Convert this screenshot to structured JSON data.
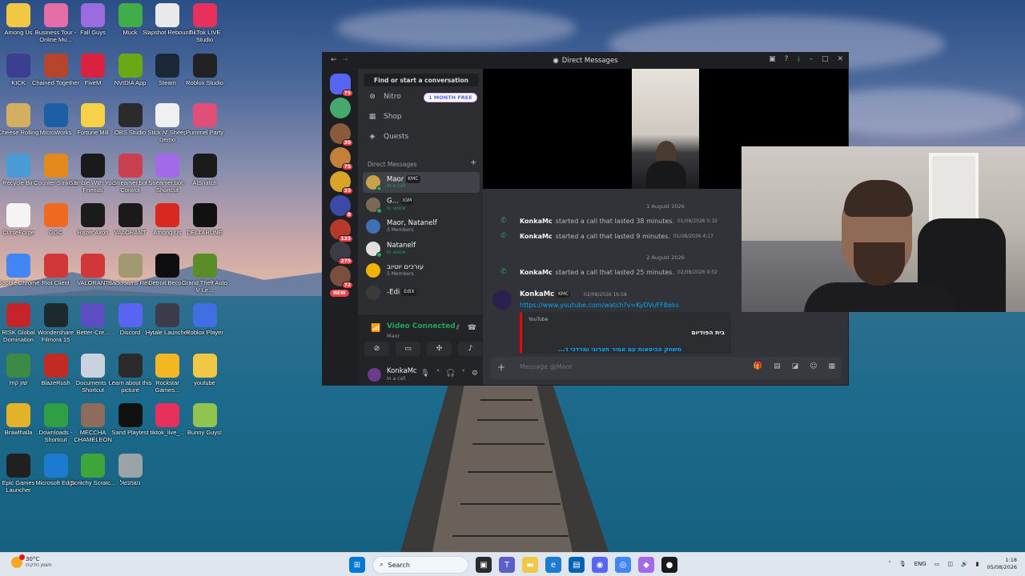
{
  "desktop_icons": [
    {
      "label": "Among Us",
      "icon": "folder-icon",
      "color": "#f2c744"
    },
    {
      "label": "Business Tour - Online Mu...",
      "icon": "business-tour-icon",
      "color": "#e46fa8"
    },
    {
      "label": "Fall Guys",
      "icon": "fall-guys-icon",
      "color": "#9b6ce0"
    },
    {
      "label": "Muck",
      "icon": "muck-icon",
      "color": "#3fae48"
    },
    {
      "label": "Slapshot Rebound",
      "icon": "slapshot-icon",
      "color": "#e9e9e9"
    },
    {
      "label": "TikTok LIVE Studio",
      "icon": "tiktok-icon",
      "color": "#e8305c"
    },
    {
      "label": "KICK",
      "icon": "kick-icon",
      "color": "#3b3f8f"
    },
    {
      "label": "Chained Together",
      "icon": "chained-icon",
      "color": "#b5452c"
    },
    {
      "label": "FiveM",
      "icon": "fivem-icon",
      "color": "#d8223f"
    },
    {
      "label": "NVIDIA App",
      "icon": "nvidia-icon",
      "color": "#6aa815"
    },
    {
      "label": "Steam",
      "icon": "steam-icon",
      "color": "#1b2838"
    },
    {
      "label": "Roblox Studio",
      "icon": "roblox-studio-icon",
      "color": "#222"
    },
    {
      "label": "Cheese Rolling",
      "icon": "cheese-icon",
      "color": "#d3b061"
    },
    {
      "label": "MicroWorks",
      "icon": "microworks-icon",
      "color": "#1d5fa5"
    },
    {
      "label": "Fortune Mill",
      "icon": "fortune-mill-icon",
      "color": "#f7d246"
    },
    {
      "label": "OBS Studio",
      "icon": "obs-icon",
      "color": "#2b2b2b"
    },
    {
      "label": "Stick N' Sheep Demo",
      "icon": "stick-sheep-icon",
      "color": "#f0f0f0"
    },
    {
      "label": "Pummel Party",
      "icon": "pummel-party-icon",
      "color": "#e04f77"
    },
    {
      "label": "Recycle Bin",
      "icon": "recycle-bin-icon",
      "color": "#4a9ad4"
    },
    {
      "label": "Counter-Strike 2",
      "icon": "cs2-icon",
      "color": "#e28b1c"
    },
    {
      "label": "Gamble With Your Friends",
      "icon": "gamble-icon",
      "color": "#1a1a1a"
    },
    {
      "label": "Streamer.bot Control",
      "icon": "streamerbot-icon",
      "color": "#c94150"
    },
    {
      "label": "Streamer.bot - Shortcut",
      "icon": "streamerbot-shortcut-icon",
      "color": "#a26ae8"
    },
    {
      "label": "AlSnatch",
      "icon": "alsnatch-icon",
      "color": "#1b1b1b"
    },
    {
      "label": "CurseForge",
      "icon": "curseforge-icon",
      "color": "#f4f4f4"
    },
    {
      "label": "GGC",
      "icon": "ggc-icon",
      "color": "#ef6a20"
    },
    {
      "label": "Razer Axon",
      "icon": "razer-icon",
      "color": "#1b1b1b"
    },
    {
      "label": "VALORANT",
      "icon": "valorant-icon",
      "color": "#1a1a1a"
    },
    {
      "label": "Among Us",
      "icon": "among-us-icon",
      "color": "#d8281f"
    },
    {
      "label": "DELTARUNE",
      "icon": "deltarune-icon",
      "color": "#111"
    },
    {
      "label": "Google Chrome",
      "icon": "chrome-icon",
      "color": "#4285f4"
    },
    {
      "label": "Riot Client",
      "icon": "riot-client-icon",
      "color": "#d13639"
    },
    {
      "label": "VALORANT",
      "icon": "valorant-riot-icon",
      "color": "#d13639"
    },
    {
      "label": "Backrooms Rec.",
      "icon": "backrooms-icon",
      "color": "#a29871"
    },
    {
      "label": "Detroit Beco...",
      "icon": "detroit-icon",
      "color": "#0e0e10"
    },
    {
      "label": "Grand Theft Auto V Le...",
      "icon": "gta-icon",
      "color": "#5b8c2a"
    },
    {
      "label": "RISK Global Domination",
      "icon": "risk-icon",
      "color": "#c4242a"
    },
    {
      "label": "Wondershare Filmora 15",
      "icon": "filmora-icon",
      "color": "#1c2a2e"
    },
    {
      "label": "Better-Cre...",
      "icon": "better-crewlink-icon",
      "color": "#5a4ec0"
    },
    {
      "label": "Discord",
      "icon": "discord-icon",
      "color": "#5865f2"
    },
    {
      "label": "Hytale Launcher",
      "icon": "hytale-icon",
      "color": "#3b3b4a"
    },
    {
      "label": "Roblox Player",
      "icon": "roblox-icon",
      "color": "#3f6fe0"
    },
    {
      "label": "שון קוזז",
      "icon": "shon-icon",
      "color": "#3c8a45"
    },
    {
      "label": "BlazeRush",
      "icon": "blazerush-icon",
      "color": "#c12b22"
    },
    {
      "label": "Documents - Shortcut",
      "icon": "documents-icon",
      "color": "#c9d3de"
    },
    {
      "label": "Learn about this picture",
      "icon": "learn-picture-icon",
      "color": "#2b2b2b"
    },
    {
      "label": "Rockstar Games...",
      "icon": "rockstar-icon",
      "color": "#f2b722"
    },
    {
      "label": "youtube",
      "icon": "youtube-folder-icon",
      "color": "#f2c744"
    },
    {
      "label": "Brawlhalla",
      "icon": "brawlhalla-icon",
      "color": "#e4b229"
    },
    {
      "label": "Downloads - Shortcut",
      "icon": "downloads-icon",
      "color": "#2ea043"
    },
    {
      "label": "MECCHA CHAMELEON",
      "icon": "meccha-icon",
      "color": "#8f6b5c"
    },
    {
      "label": "Sand Playtest",
      "icon": "sand-icon",
      "color": "#111"
    },
    {
      "label": "tiktok_live_...",
      "icon": "tiktok-live-icon",
      "color": "#e8305c"
    },
    {
      "label": "Bunny Guys!",
      "icon": "bunny-guys-icon",
      "color": "#8fc451"
    },
    {
      "label": "Epic Games Launcher",
      "icon": "epic-icon",
      "color": "#202020"
    },
    {
      "label": "Microsoft Edge",
      "icon": "edge-icon",
      "color": "#1b7bd0"
    },
    {
      "label": "Scritchy Scratc...",
      "icon": "scritchy-icon",
      "color": "#3ea53b"
    },
    {
      "label": "נשמנשל",
      "icon": "hebrew-file-icon",
      "color": "#9aa3a8"
    }
  ],
  "discord": {
    "title": "Direct Messages",
    "find_placeholder": "Find or start a conversation",
    "nav": [
      {
        "label": "Nitro",
        "icon": "nitro-icon"
      },
      {
        "label": "Shop",
        "icon": "shop-icon"
      },
      {
        "label": "Quests",
        "icon": "quests-icon"
      }
    ],
    "promo": "1 MONTH FREE",
    "dm_header": "Direct Messages",
    "guild_badges": [
      "75",
      "",
      "30",
      "75",
      "33",
      "8",
      "133",
      "275",
      "72"
    ],
    "new_badge": "NEW",
    "dms": [
      {
        "name": "Maor",
        "tag": "KMC",
        "sub": "In a call",
        "color": "#c8a24a",
        "active": true
      },
      {
        "name": "G...",
        "tag": "IGM",
        "sub": "In voice",
        "color": "#7a6a55",
        "active": false
      },
      {
        "name": "Maor, Natanelf",
        "tag": "",
        "sub": "3 Members",
        "color": "#3f6fb5",
        "active": false
      },
      {
        "name": "Natanelf",
        "tag": "",
        "sub": "In voice",
        "color": "#e0e0e0",
        "active": false
      },
      {
        "name": "עורכים יוטיוב",
        "tag": "",
        "sub": "5 Members",
        "color": "#f0b400",
        "active": false
      },
      {
        "name": "-Edi",
        "tag": "EdiX",
        "sub": "",
        "color": "#3a3a3a",
        "active": false
      }
    ],
    "voice": {
      "title": "Video Connected",
      "sub": "Maor"
    },
    "user": {
      "name": "KonkaMc",
      "sub": "In a call"
    },
    "date_dividers": [
      "1 August 2026",
      "2 August 2026"
    ],
    "calls": [
      {
        "who": "KonkaMc",
        "text": "started a call that lasted 38 minutes.",
        "ts": "01/08/2026 0:32"
      },
      {
        "who": "KonkaMc",
        "text": "started a call that lasted 9 minutes.",
        "ts": "01/08/2026 4:17"
      },
      {
        "who": "KonkaMc",
        "text": "started a call that lasted 25 minutes.",
        "ts": "02/08/2026 0:02"
      }
    ],
    "message": {
      "author": "KonkaMc",
      "tag": "KMC",
      "ts": "02/08/2026 16:58",
      "link": "https://www.youtube.com/watch?v=KyDVuFFBeks",
      "embed_provider": "YouTube",
      "embed_title": "בית הפודיום",
      "embed_link": "משחק הכיסאות עם אמיר חצרוני ומרדכי ד..."
    },
    "composer_placeholder": "Message @Maor"
  },
  "taskbar": {
    "weather_temp": "30°C",
    "weather_desc": "חשמן חלקית",
    "search": "Search",
    "lang": "ENG",
    "time": "1:18",
    "date": "05/08/2026"
  }
}
